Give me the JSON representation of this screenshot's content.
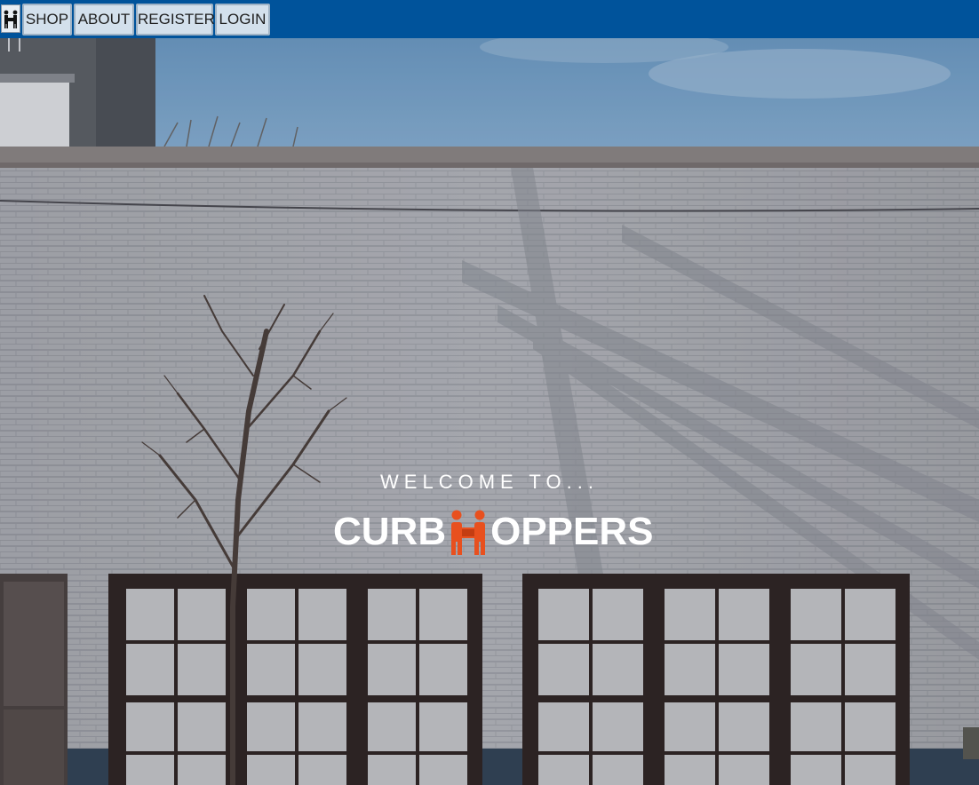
{
  "nav": {
    "logo_icon": "curbhoppers-people-carrying-box-icon",
    "items": [
      {
        "label": "SHOP"
      },
      {
        "label": "ABOUT"
      },
      {
        "label": "REGISTER"
      },
      {
        "label": "LOGIN"
      }
    ]
  },
  "hero": {
    "welcome": "WELCOME TO...",
    "brand_prefix": "CURB",
    "brand_mark_icon": "people-carrying-box-icon",
    "brand_suffix": "OPPERS",
    "brand_accent_color": "#e8501e"
  },
  "colors": {
    "nav_background": "#00539b",
    "nav_button_background": "#d3e0ec"
  }
}
